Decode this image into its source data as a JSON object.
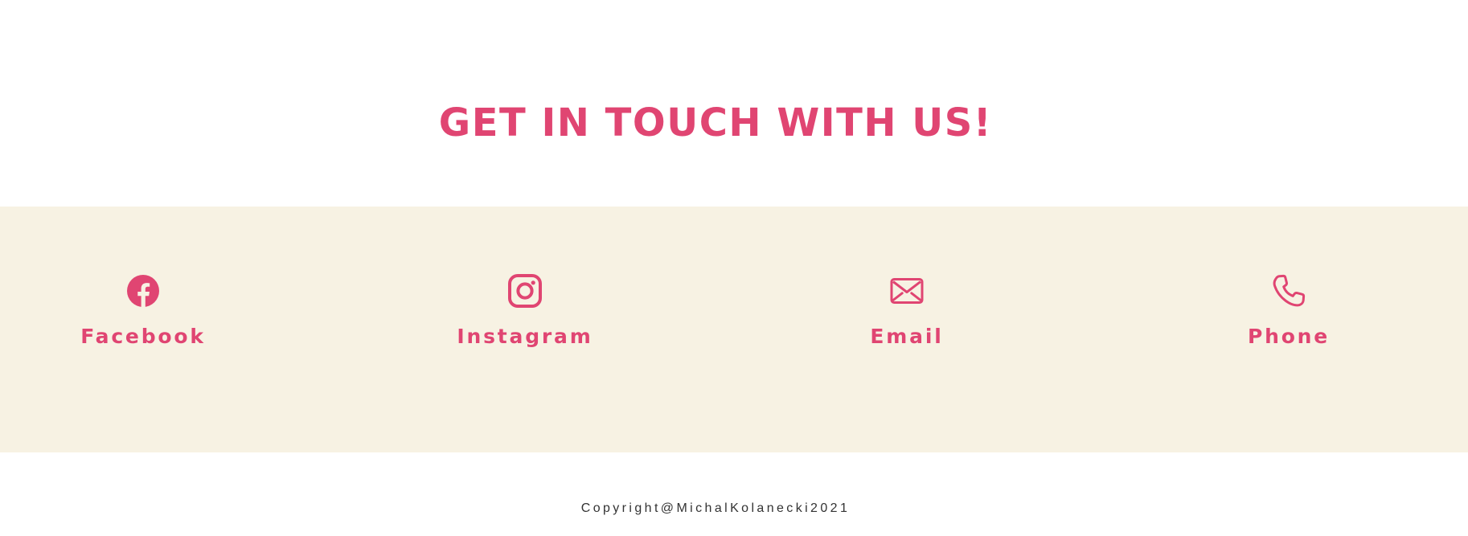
{
  "heading": {
    "title": "GET IN TOUCH WITH US!"
  },
  "contacts": {
    "items": [
      {
        "label": "Facebook",
        "icon": "facebook-icon"
      },
      {
        "label": "Instagram",
        "icon": "instagram-icon"
      },
      {
        "label": "Email",
        "icon": "email-icon"
      },
      {
        "label": "Phone",
        "icon": "phone-icon"
      }
    ]
  },
  "footer": {
    "copyright": "Copyright@MichalKolanecki2021"
  },
  "theme": {
    "accent": "#e04572",
    "band_background": "#f7f2e3",
    "background": "#ffffff",
    "footer_text": "#333333"
  }
}
